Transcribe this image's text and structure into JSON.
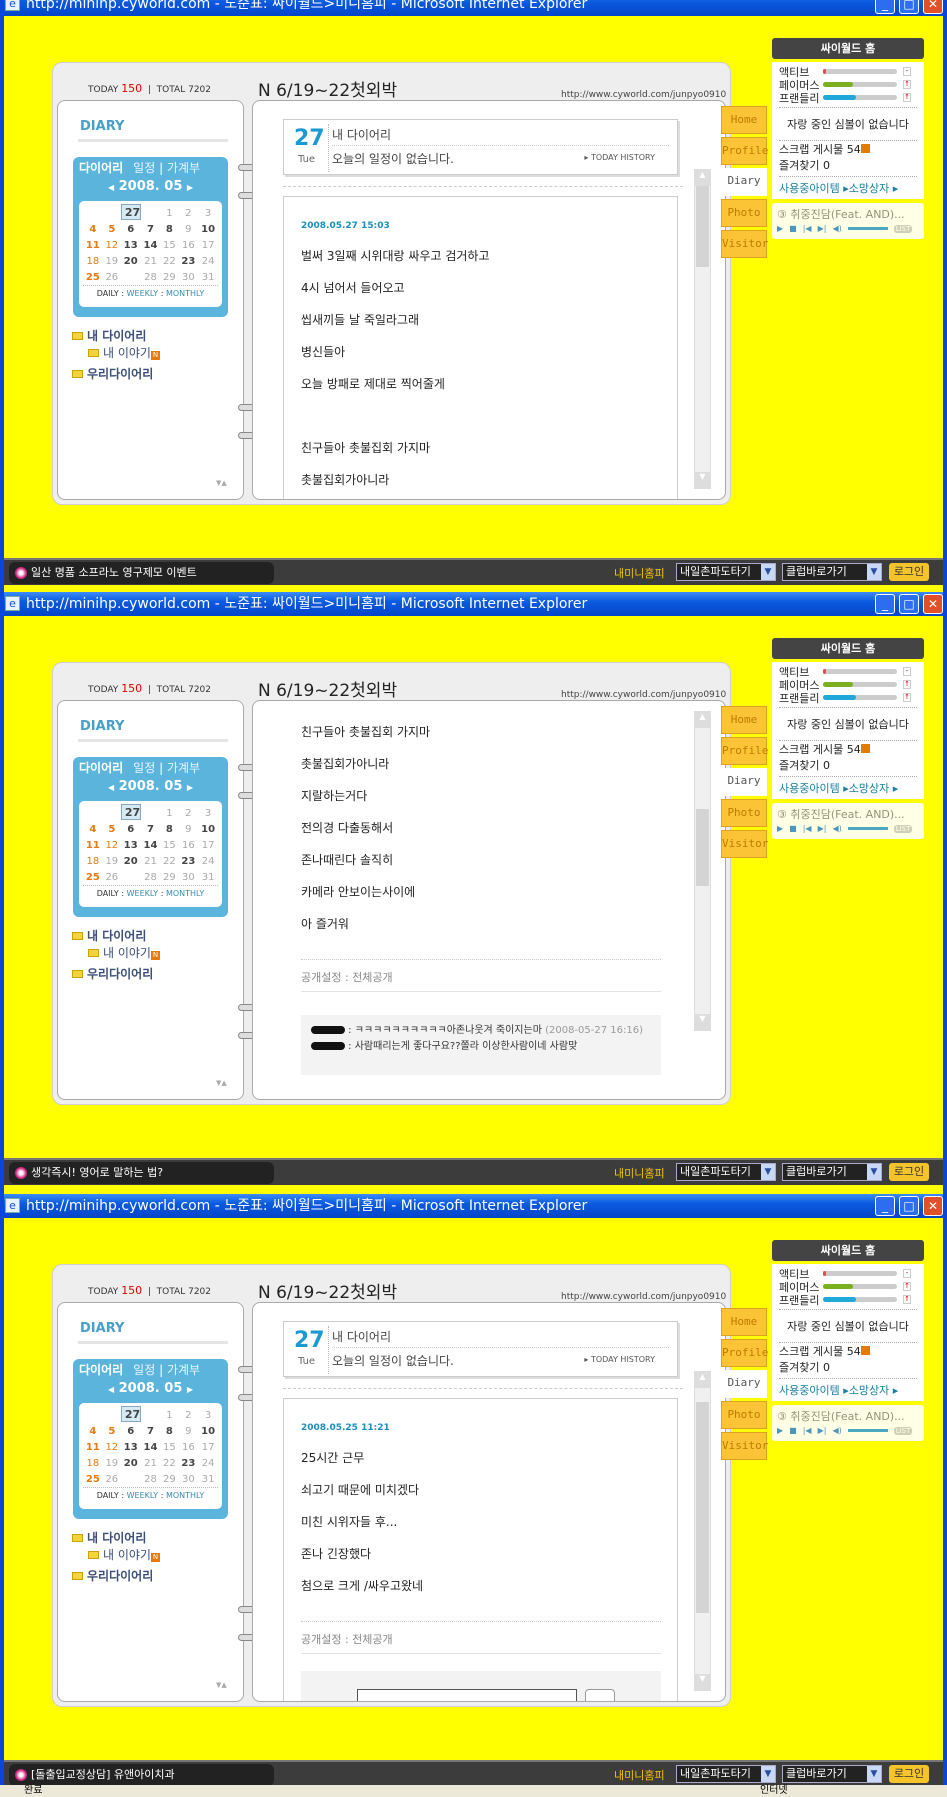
{
  "window_title": "http://minihp.cyworld.com - 노준표: 싸이월드>미니홈피 - Microsoft Internet Explorer",
  "header": {
    "today_label": "TODAY",
    "today_count": "150",
    "total_label": "TOTAL",
    "total_count": "7202",
    "title": "N 6/19~22첫외박",
    "url": "http://www.cyworld.com/junpyo0910"
  },
  "left": {
    "section": "DIARY",
    "calendar": {
      "tabs": [
        "다이어리",
        "일정",
        "가계부"
      ],
      "month": "2008. 05",
      "weeks": [
        [
          "",
          "",
          "",
          "",
          "1",
          "2",
          "3"
        ],
        [
          "4",
          "5",
          "6",
          "7",
          "8",
          "9",
          "10"
        ],
        [
          "11",
          "12",
          "13",
          "14",
          "15",
          "16",
          "17"
        ],
        [
          "18",
          "19",
          "20",
          "21",
          "22",
          "23",
          "24"
        ],
        [
          "25",
          "26",
          "27",
          "28",
          "29",
          "30",
          "31"
        ]
      ],
      "entry_days": [
        "4",
        "5",
        "6",
        "7",
        "8",
        "10",
        "11",
        "13",
        "14",
        "20",
        "23",
        "25",
        "27"
      ],
      "holiday_days": [
        "4",
        "5",
        "11",
        "12",
        "18",
        "25"
      ],
      "selected_day": "27",
      "modes": [
        "DAILY",
        "WEEKLY",
        "MONTHLY"
      ]
    },
    "tree": {
      "root": "내 다이어리",
      "child": "내 이야기",
      "child_badge": "N",
      "other": "우리다이어리"
    }
  },
  "today_box": {
    "day": "27",
    "weekday": "Tue",
    "title": "내 다이어리",
    "schedule": "오늘의 일정이 없습니다.",
    "history": "TODAY HISTORY"
  },
  "tabs": [
    "Home",
    "Profile",
    "Diary",
    "Photo",
    "Visitor"
  ],
  "active_tab": "Diary",
  "right_panel": {
    "home": "싸이월드 홈",
    "meters": [
      {
        "label": "액티브",
        "level": 0.04,
        "color": "#e05050",
        "arrow": "-"
      },
      {
        "label": "페이머스",
        "level": 0.4,
        "color": "#7ab020",
        "arrow": "↑"
      },
      {
        "label": "프랜들리",
        "level": 0.45,
        "color": "#20a8d8",
        "arrow": "↑"
      }
    ],
    "symbol_msg": "자랑 중인 심볼이 없습니다",
    "scrap_label": "스크랩 게시물",
    "scrap_count": "54",
    "fav_label": "즐겨찾기",
    "fav_count": "0",
    "items": "사용중아이템 ▸소망상자 ▸",
    "song": "③ 취중진담(Feat. AND)...",
    "list": "LIST"
  },
  "bottom": {
    "my_home": "내미니홈피",
    "select1": "내일촌파도타기",
    "select2": "클럽바로가기",
    "login": "로그인"
  },
  "windows": [
    {
      "ad": "일산 명품 소프라노 영구제모 이벤트",
      "show_today": true,
      "scroll": [
        0,
        0.28
      ],
      "entry": {
        "date": "2008.05.27 15:03",
        "lines": [
          "벌써 3일째 시위대랑 싸우고 검거하고",
          "4시 넘어서 들어오고",
          "씹새끼들 날 죽일라그래",
          "병신들아",
          "오늘 방패로 제대로 찍어줄게",
          "",
          "친구들아 촛불집회 가지마",
          "촛불집회가아니라"
        ]
      }
    },
    {
      "ad": "생각즉시! 영어로 말하는 법?",
      "show_today": false,
      "scroll": [
        0.28,
        0.55
      ],
      "entry": {
        "lines": [
          "친구들아 촛불집회 가지마",
          "촛불집회가아니라",
          "지랄하는거다",
          "전의경 다출동해서",
          "존나때린다 솔직히",
          "카메라 안보이는사이에",
          "아 즐거워"
        ]
      },
      "privacy": "공개설정 : 전체공개",
      "comments": [
        {
          "text": " : ㅋㅋㅋㅋㅋㅋㅋㅋㅋㅋ아존나웃겨 죽이지는마 ",
          "time": "(2008-05-27 16:16)"
        },
        {
          "text": " : 사람때리는게 좋다구요??쫄라 이상한사람이네 사람맞",
          "time": ""
        }
      ]
    },
    {
      "ad": "[돌출입교정상담] 유앤아이치과",
      "show_today": true,
      "scroll": [
        0.05,
        0.78
      ],
      "entry": {
        "date": "2008.05.25 11:21",
        "lines": [
          "25시간 근무",
          "쇠고기 때문에 미치겠다",
          "미친 시위자들 후...",
          "존나 긴장했다",
          "첨으로 크게 /싸우고왔네"
        ]
      },
      "privacy": "공개설정 : 전체공개",
      "comment_input": true
    }
  ],
  "statusbar": {
    "left": "완료",
    "zone": "인터넷"
  }
}
